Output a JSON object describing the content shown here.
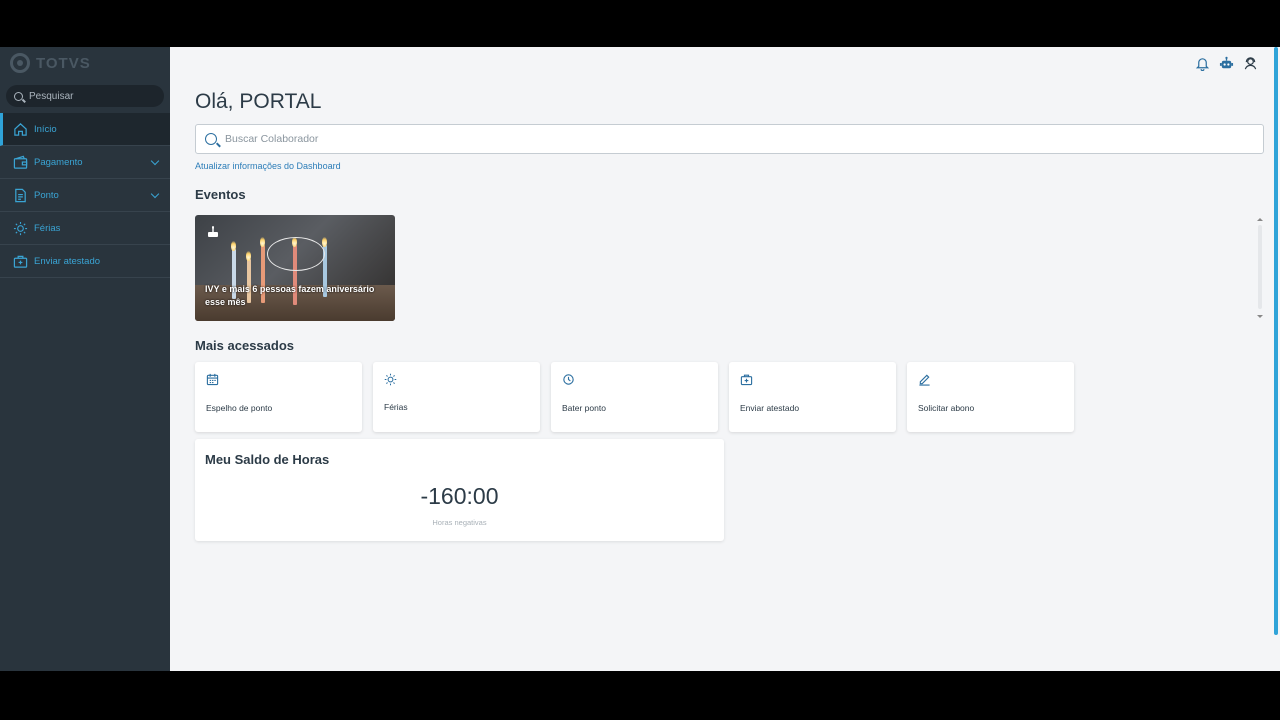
{
  "sidebar": {
    "logo_text": "TOTVS",
    "search_placeholder": "Pesquisar",
    "items": [
      {
        "label": "Início",
        "icon": "home-icon"
      },
      {
        "label": "Pagamento",
        "icon": "wallet-icon"
      },
      {
        "label": "Ponto",
        "icon": "document-icon"
      },
      {
        "label": "Férias",
        "icon": "sun-icon"
      },
      {
        "label": "Enviar atestado",
        "icon": "medical-bag-icon"
      }
    ]
  },
  "header": {
    "icons": [
      "bell-icon",
      "robot-icon",
      "user-support-icon"
    ]
  },
  "main": {
    "greeting": "Olá, PORTAL",
    "collab_search_placeholder": "Buscar Colaborador",
    "update_link": "Atualizar informações do Dashboard",
    "events_title": "Eventos",
    "event_card": {
      "icon": "cake-icon",
      "text": "IVY e mais 6 pessoas fazem aniversário esse mês"
    },
    "most_accessed_title": "Mais acessados",
    "quick_links": [
      {
        "label": "Espelho de ponto",
        "icon": "calendar-icon"
      },
      {
        "label": "Férias",
        "icon": "sun-icon"
      },
      {
        "label": "Bater ponto",
        "icon": "clock-icon"
      },
      {
        "label": "Enviar atestado",
        "icon": "medical-bag-icon"
      },
      {
        "label": "Solicitar abono",
        "icon": "edit-icon"
      }
    ],
    "saldo": {
      "title": "Meu Saldo de Horas",
      "value": "-160:00",
      "subtitle": "Horas negativas"
    }
  },
  "colors": {
    "sidebar_bg": "#29343d",
    "accent": "#2fa3d8",
    "text_dark": "#2c3b47"
  }
}
